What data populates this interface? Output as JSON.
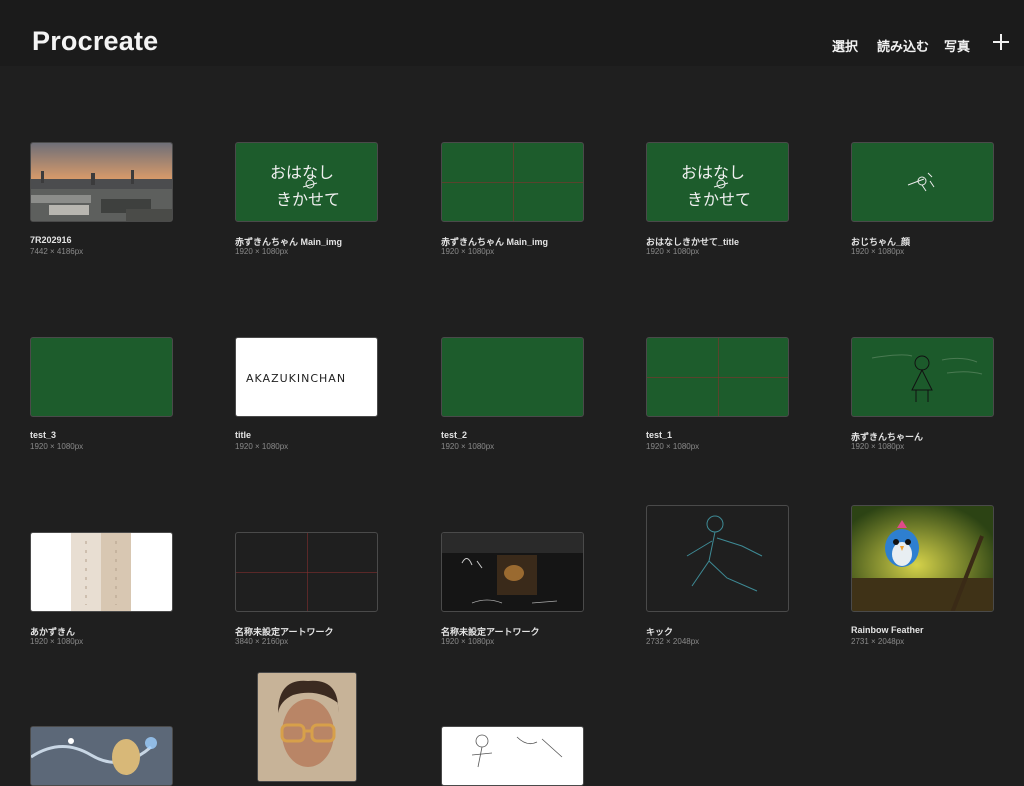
{
  "app": {
    "title": "Procreate"
  },
  "toolbar": {
    "select_label": "選択",
    "import_label": "読み込む",
    "photo_label": "写真",
    "add_icon": "plus-icon"
  },
  "artworks": [
    {
      "title": "7R202916",
      "size": "7442 × 4186px"
    },
    {
      "title": "赤ずきんちゃん Main_img",
      "size": "1920 × 1080px"
    },
    {
      "title": "赤ずきんちゃん Main_img",
      "size": "1920 × 1080px"
    },
    {
      "title": "おはなしきかせて_title",
      "size": "1920 × 1080px"
    },
    {
      "title": "おじちゃん_顔",
      "size": "1920 × 1080px"
    },
    {
      "title": "test_3",
      "size": "1920 × 1080px"
    },
    {
      "title": "title",
      "size": "1920 × 1080px"
    },
    {
      "title": "test_2",
      "size": "1920 × 1080px"
    },
    {
      "title": "test_1",
      "size": "1920 × 1080px"
    },
    {
      "title": "赤ずきんちゃーん",
      "size": "1920 × 1080px"
    },
    {
      "title": "あかずきん",
      "size": "1920 × 1080px"
    },
    {
      "title": "名称未設定アートワーク",
      "size": "3840 × 2160px"
    },
    {
      "title": "名称未設定アートワーク",
      "size": "1920 × 1080px"
    },
    {
      "title": "キック",
      "size": "2732 × 2048px"
    },
    {
      "title": "Rainbow Feather",
      "size": "2731 × 2048px"
    }
  ],
  "thumb_text": {
    "ohanashi_line1": "おはなし",
    "ohanashi_line2": "きかせて",
    "akazukin": "AKAZUKINCHAN"
  },
  "colors": {
    "background": "#1f1f1f",
    "canvas_green": "#1d5c2c",
    "guide_red": "#8a2f2f"
  }
}
